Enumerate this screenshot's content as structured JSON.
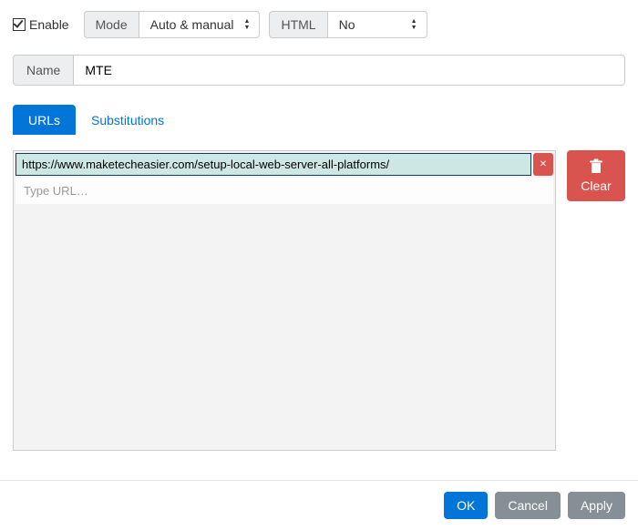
{
  "enable": {
    "label": "Enable",
    "checked": true
  },
  "mode": {
    "label": "Mode",
    "value": "Auto & manual"
  },
  "html": {
    "label": "HTML",
    "value": "No"
  },
  "name": {
    "label": "Name",
    "value": "MTE"
  },
  "tabs": {
    "urls": "URLs",
    "subs": "Substitutions",
    "active": "urls"
  },
  "urls": {
    "items": [
      "https://www.maketecheasier.com/setup-local-web-server-all-platforms/"
    ],
    "placeholder": "Type URL…"
  },
  "clear": "Clear",
  "footer": {
    "ok": "OK",
    "cancel": "Cancel",
    "apply": "Apply"
  }
}
